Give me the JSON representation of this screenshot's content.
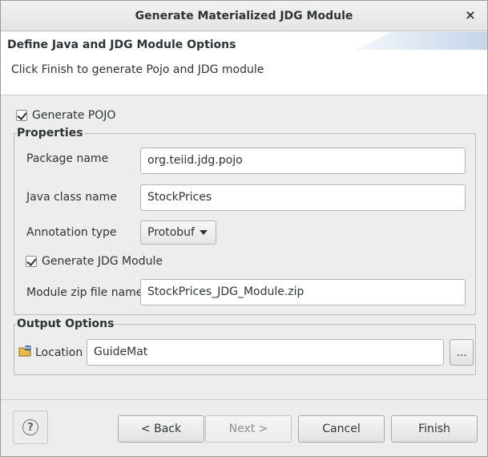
{
  "window": {
    "title": "Generate Materialized JDG Module",
    "close_glyph": "×"
  },
  "banner": {
    "heading": "Define Java and JDG Module Options",
    "description": "Click Finish to generate Pojo and JDG module"
  },
  "generate_pojo": {
    "label": "Generate POJO",
    "checked": true
  },
  "properties": {
    "legend": "Properties",
    "package_name": {
      "label": "Package name",
      "value": "org.teiid.jdg.pojo"
    },
    "java_class_name": {
      "label": "Java class name",
      "value": "StockPrices"
    },
    "annotation_type": {
      "label": "Annotation type",
      "selected": "Protobuf"
    },
    "generate_jdg_module": {
      "label": "Generate JDG Module",
      "checked": true
    },
    "module_zip_file_name": {
      "label": "Module zip file name",
      "value": "StockPrices_JDG_Module.zip"
    }
  },
  "output_options": {
    "legend": "Output Options",
    "location": {
      "label": "Location",
      "value": "GuideMat",
      "browse_label": "...",
      "icon": "folder-icon"
    }
  },
  "buttons": {
    "help_glyph": "?",
    "back": "< Back",
    "next": "Next >",
    "cancel": "Cancel",
    "finish": "Finish"
  }
}
